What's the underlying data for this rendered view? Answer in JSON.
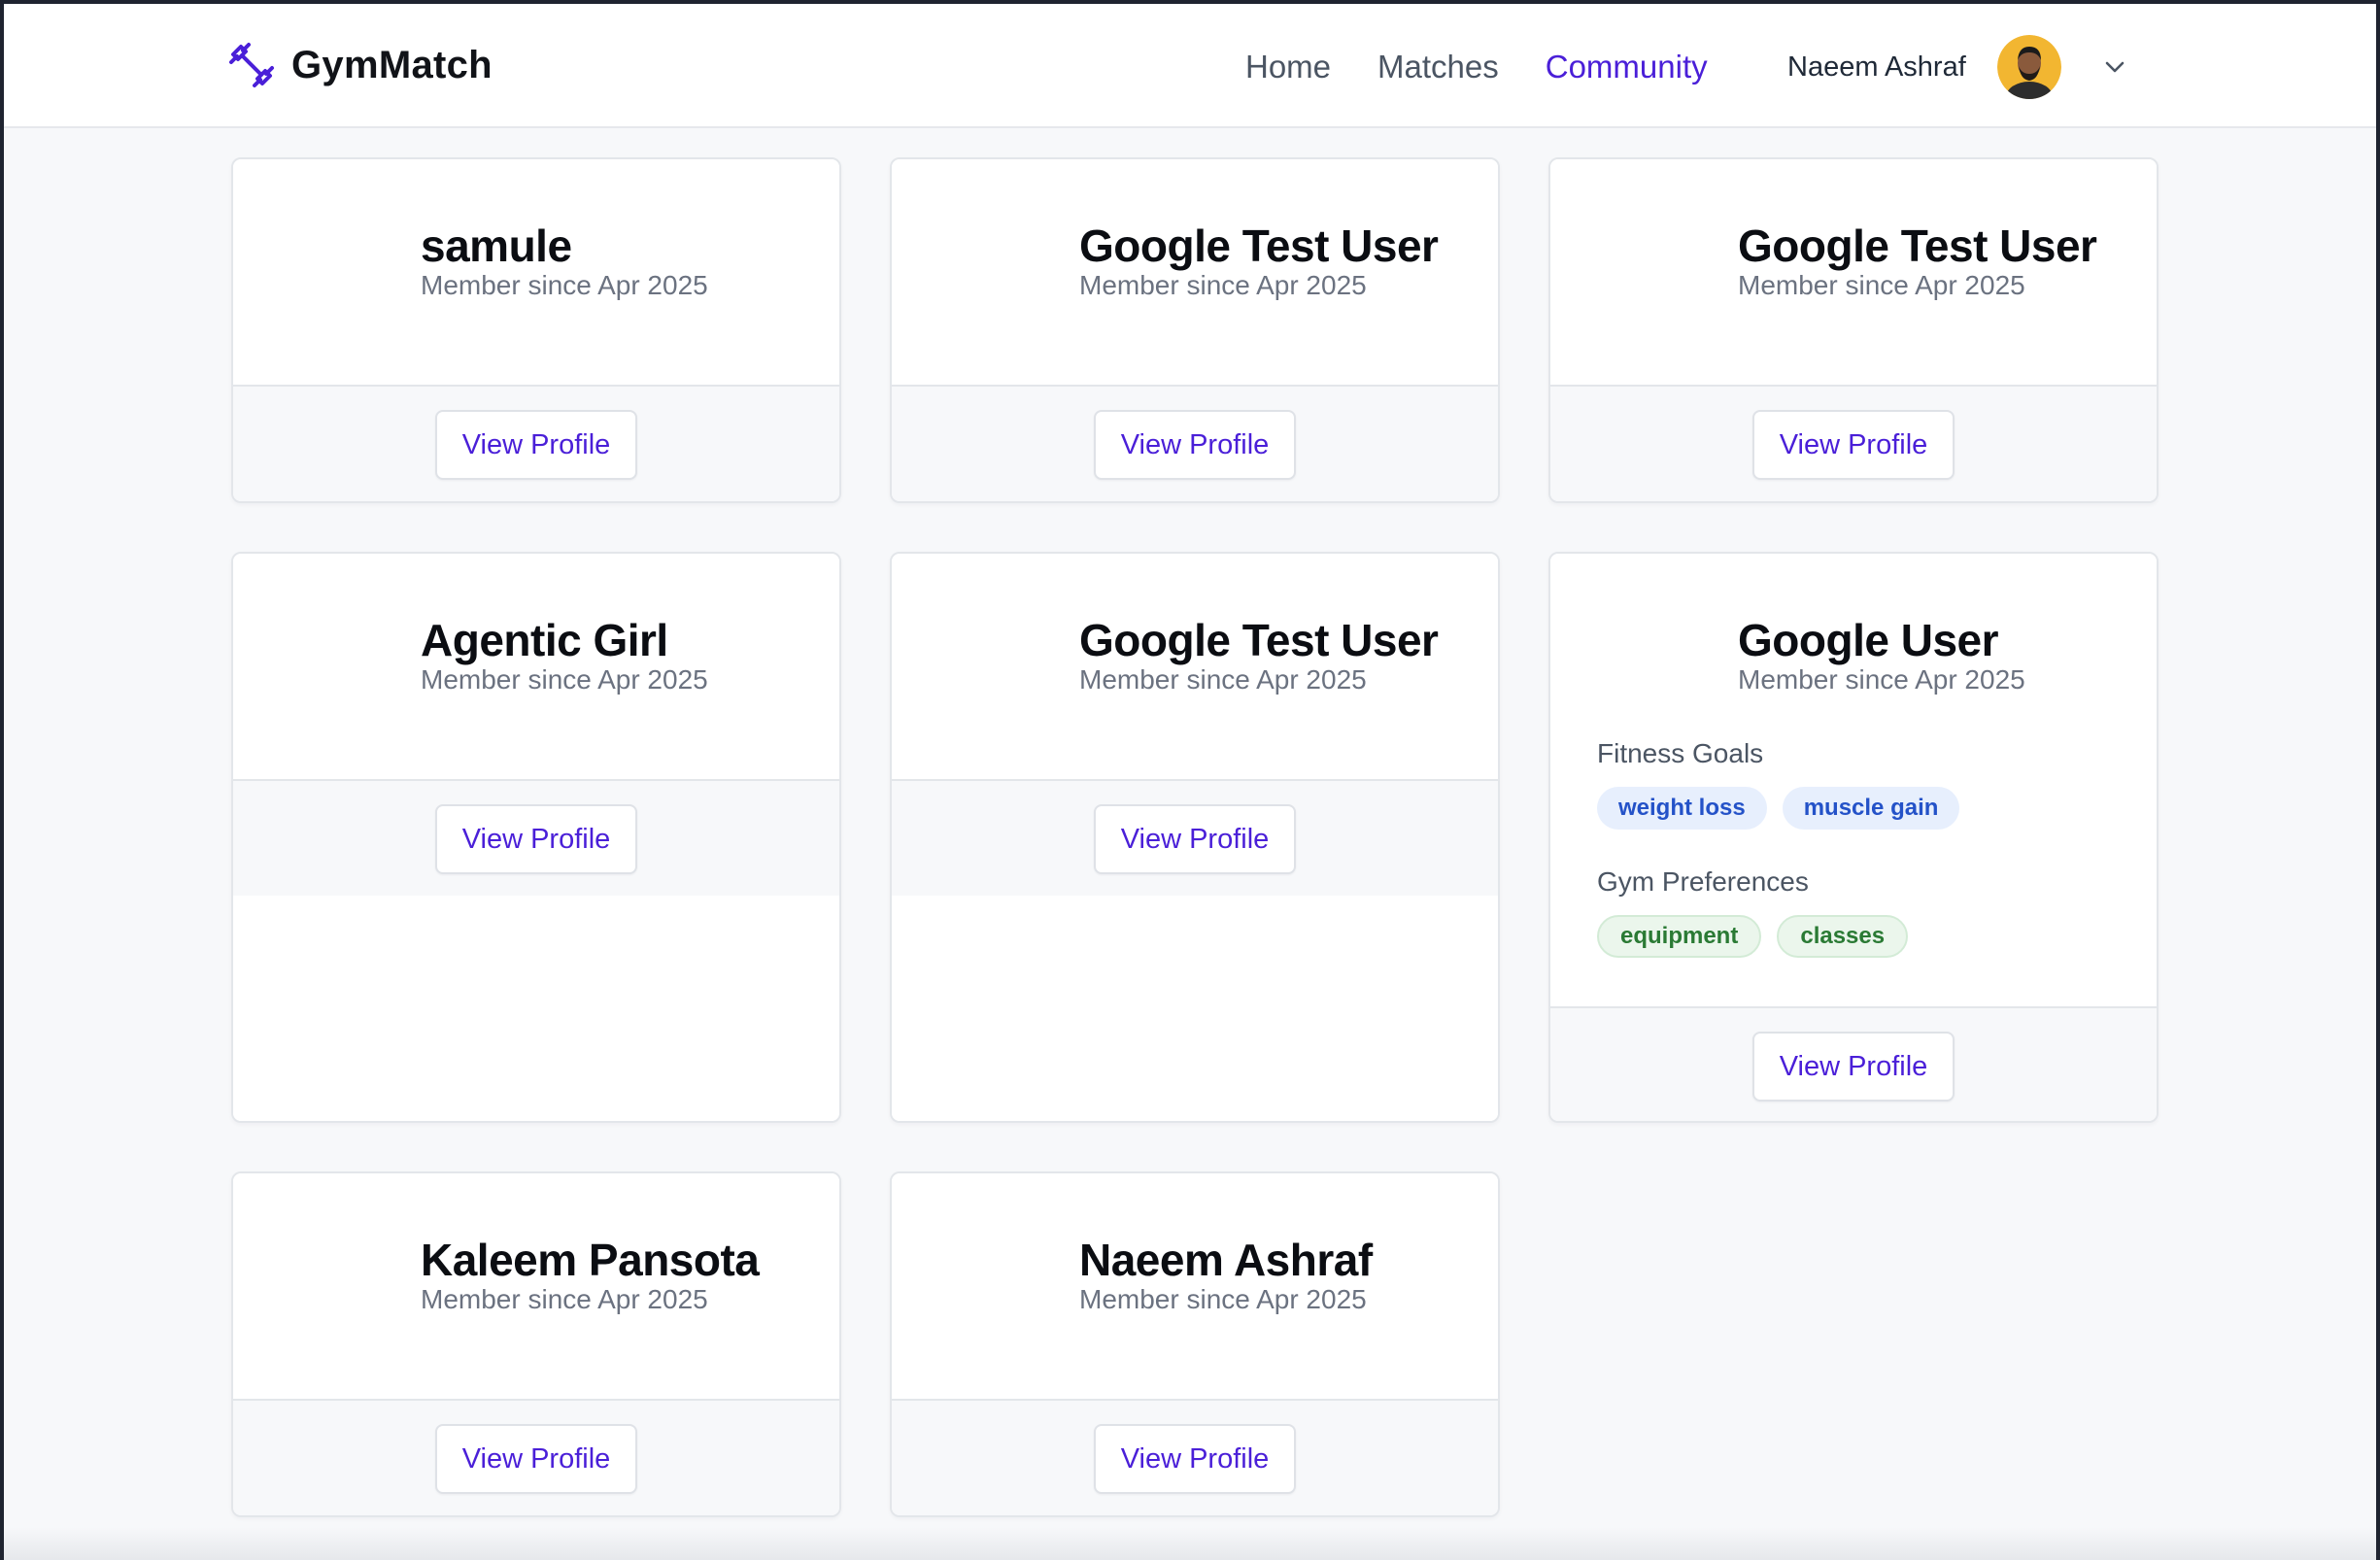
{
  "header": {
    "brand": "GymMatch",
    "nav": [
      {
        "label": "Home",
        "active": false
      },
      {
        "label": "Matches",
        "active": false
      },
      {
        "label": "Community",
        "active": true
      }
    ],
    "user_name": "Naeem Ashraf"
  },
  "colors": {
    "accent": "#4a1fd8",
    "goal_chip_bg": "#e7effd",
    "goal_chip_text": "#2452c8",
    "pref_chip_bg": "#ebf6ec",
    "pref_chip_text": "#2a7a34"
  },
  "icons": {
    "brand": "dumbbell-icon",
    "user_menu": "chevron-down-icon"
  },
  "cards": [
    {
      "name": "samule",
      "since": "Member since Apr 2025",
      "button": "View Profile"
    },
    {
      "name": "Google Test User",
      "since": "Member since Apr 2025",
      "button": "View Profile"
    },
    {
      "name": "Google Test User",
      "since": "Member since Apr 2025",
      "button": "View Profile"
    },
    {
      "name": "Agentic Girl",
      "since": "Member since Apr 2025",
      "button": "View Profile"
    },
    {
      "name": "Google Test User",
      "since": "Member since Apr 2025",
      "button": "View Profile"
    },
    {
      "name": "Google User",
      "since": "Member since Apr 2025",
      "button": "View Profile",
      "fitness_goals_label": "Fitness Goals",
      "fitness_goals": [
        "weight loss",
        "muscle gain"
      ],
      "gym_preferences_label": "Gym Preferences",
      "gym_preferences": [
        "equipment",
        "classes"
      ]
    },
    {
      "name": "Kaleem Pansota",
      "since": "Member since Apr 2025",
      "button": "View Profile"
    },
    {
      "name": "Naeem Ashraf",
      "since": "Member since Apr 2025",
      "button": "View Profile"
    }
  ]
}
